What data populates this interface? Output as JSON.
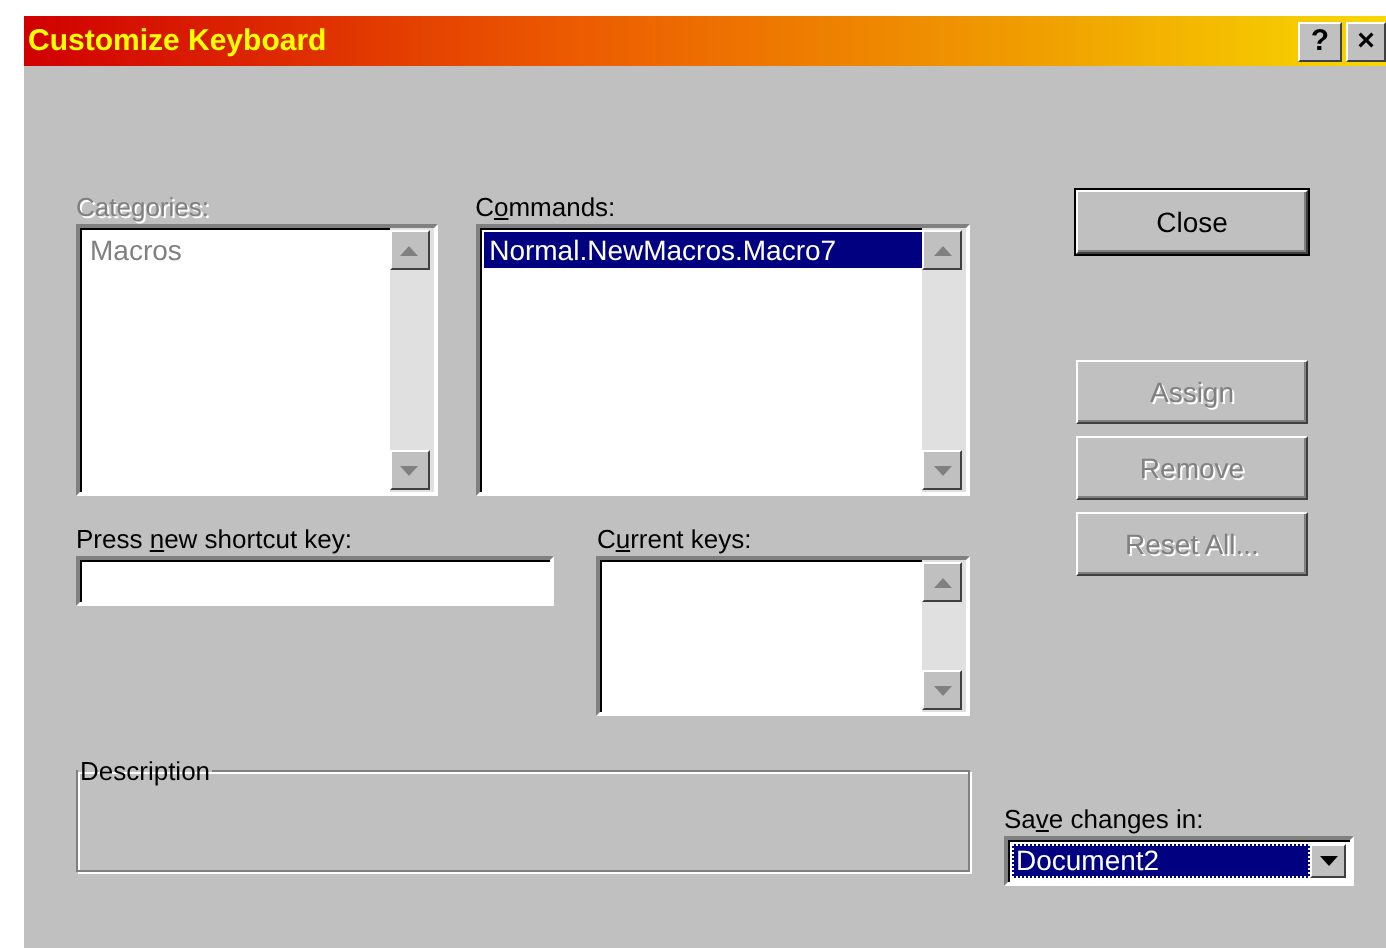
{
  "window": {
    "title": "Customize Keyboard",
    "title_buttons": [
      {
        "kind": "help",
        "text": "?"
      },
      {
        "kind": "close",
        "text": "×"
      }
    ]
  },
  "categories": {
    "label": "Categories:",
    "disabled": true,
    "items": [
      {
        "text": "Macros",
        "selected": false
      }
    ]
  },
  "commands": {
    "label": {
      "pre": "C",
      "key": "o",
      "post": "mmands:"
    },
    "items": [
      {
        "text": "Normal.NewMacros.Macro7",
        "selected": true
      }
    ]
  },
  "shortcut": {
    "label": {
      "pre": "Press ",
      "key": "n",
      "post": "ew shortcut key:"
    }
  },
  "current_keys": {
    "label": {
      "pre": "C",
      "key": "u",
      "post": "rrent keys:"
    }
  },
  "description": {
    "label": "Description"
  },
  "save_in": {
    "label": {
      "pre": "Sa",
      "key": "v",
      "post": "e changes in:"
    },
    "value": "Document2",
    "focused": true
  },
  "buttons": [
    {
      "label": "Close",
      "disabled": false,
      "default": true
    },
    {
      "label": "Assign",
      "disabled": true,
      "default": false
    },
    {
      "label": "Remove",
      "disabled": true,
      "default": false
    },
    {
      "label": "Reset All...",
      "disabled": true,
      "default": false
    }
  ]
}
